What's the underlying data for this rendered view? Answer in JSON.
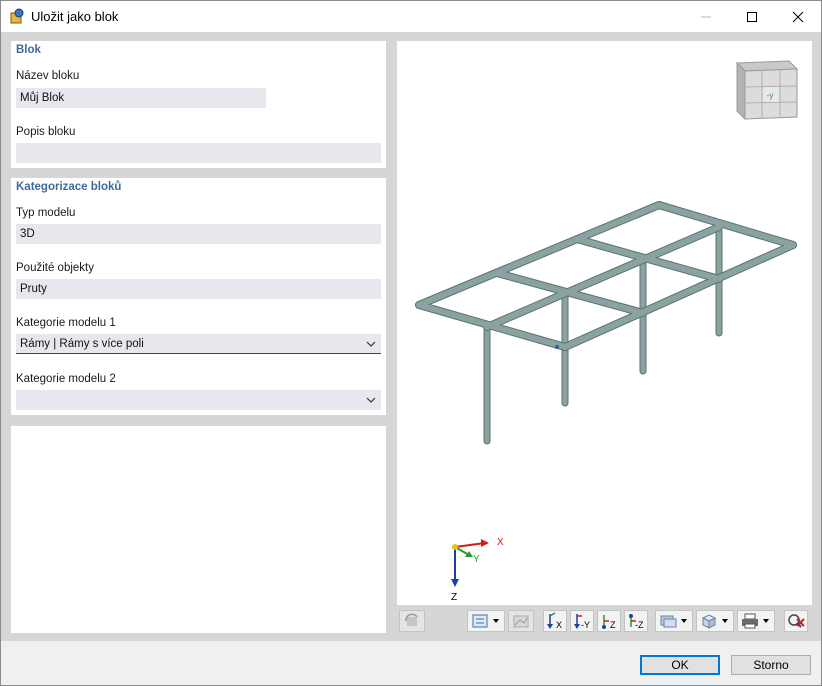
{
  "window": {
    "title": "Uložit jako blok"
  },
  "blok": {
    "section_title": "Blok",
    "name_label": "Název bloku",
    "name_value": "Můj Blok",
    "desc_label": "Popis bloku",
    "desc_value": ""
  },
  "kategorizace": {
    "section_title": "Kategorizace bloků",
    "model_type_label": "Typ modelu",
    "model_type_value": "3D",
    "objects_label": "Použité objekty",
    "objects_value": "Pruty",
    "category1_label": "Kategorie modelu 1",
    "category1_value": "Rámy | Rámy s více poli",
    "category2_label": "Kategorie modelu 2",
    "category2_value": ""
  },
  "viewport": {
    "nav_cube_label": "-y",
    "axis_x": "X",
    "axis_y": "Y",
    "axis_z": "Z"
  },
  "toolbar_icons": [
    "rotate-view-icon",
    "display-options-icon",
    "render-settings-icon",
    "view-x-icon",
    "view-neg-y-icon",
    "view-z-icon",
    "view-neg-z-icon",
    "visibility-icon",
    "iso-view-icon",
    "print-icon",
    "reset-view-icon"
  ],
  "footer": {
    "ok_label": "OK",
    "cancel_label": "Storno"
  },
  "colors": {
    "section_title": "#3f6a98",
    "field_bg": "#e7e7ee",
    "beam": "#7f9c9a",
    "accent": "#0078d7"
  }
}
